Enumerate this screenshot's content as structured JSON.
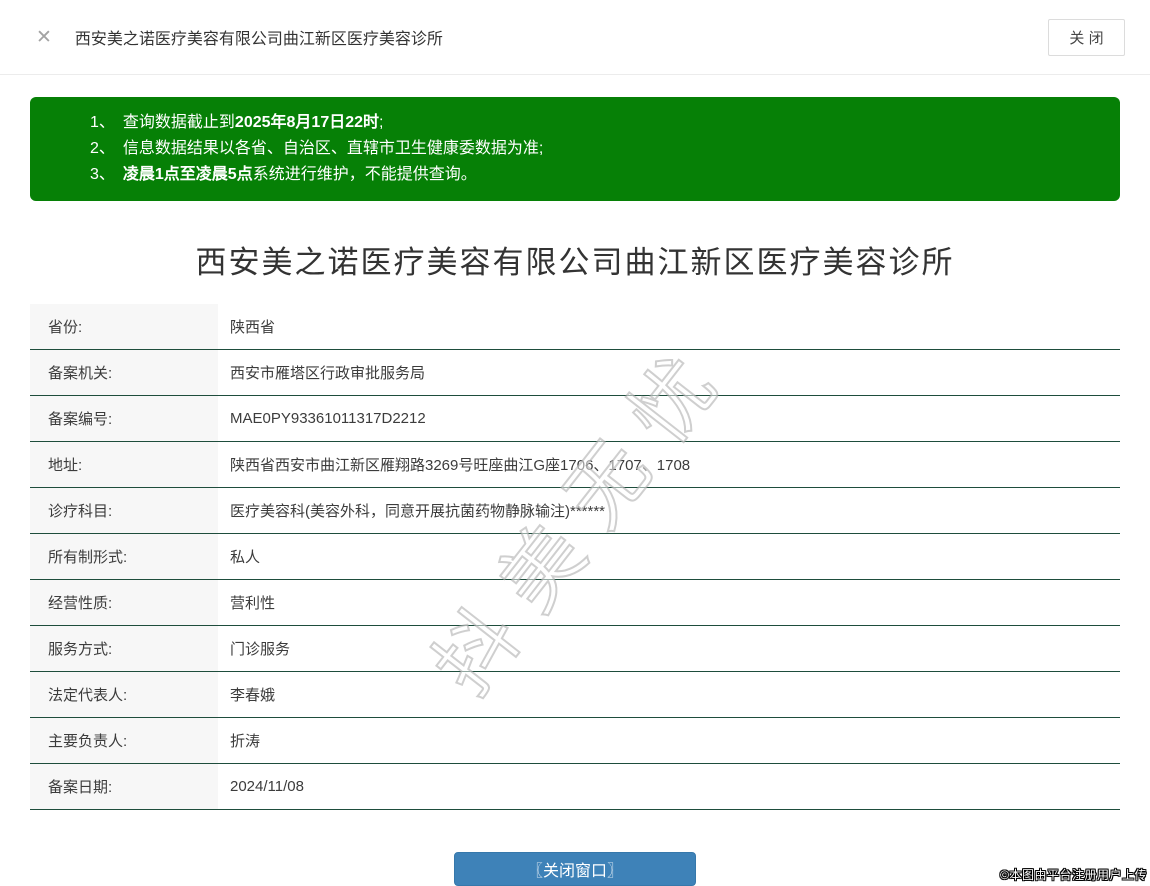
{
  "colors": {
    "notice_bg": "#068006",
    "divider": "#1e4d3c",
    "label_bg": "#f7f7f7",
    "button_blue": "#3e82b8",
    "text": "#3c3c3c"
  },
  "header": {
    "close_icon": "✕",
    "title": "西安美之诺医疗美容有限公司曲江新区医疗美容诊所",
    "close_button_label": "关 闭"
  },
  "notice": {
    "items": [
      {
        "num": "1、",
        "pre": "查询数据截止到",
        "bold": "2025年8月17日22时",
        "post": ";"
      },
      {
        "num": "2、",
        "pre": "信息数据结果以各省、自治区、直辖市卫生健康委数据为准;",
        "bold": "",
        "post": ""
      },
      {
        "num": "3、",
        "pre": "",
        "bold": "凌晨1点至凌晨5点",
        "post": "系统进行维护，不能提供查询。"
      }
    ]
  },
  "page_title": "西安美之诺医疗美容有限公司曲江新区医疗美容诊所",
  "table": {
    "rows": [
      {
        "label": "省份:",
        "value": "陕西省"
      },
      {
        "label": "备案机关:",
        "value": "西安市雁塔区行政审批服务局"
      },
      {
        "label": "备案编号:",
        "value": "MAE0PY93361011317D2212"
      },
      {
        "label": "地址:",
        "value": "陕西省西安市曲江新区雁翔路3269号旺座曲江G座1706、1707、1708"
      },
      {
        "label": "诊疗科目:",
        "value": "医疗美容科(美容外科，同意开展抗菌药物静脉输注)******"
      },
      {
        "label": "所有制形式:",
        "value": "私人"
      },
      {
        "label": "经营性质:",
        "value": "营利性"
      },
      {
        "label": "服务方式:",
        "value": "门诊服务"
      },
      {
        "label": "法定代表人:",
        "value": "李春娥"
      },
      {
        "label": "主要负责人:",
        "value": "折涛"
      },
      {
        "label": "备案日期:",
        "value": "2024/11/08"
      }
    ]
  },
  "bottom": {
    "close_window_button_label": "〖关闭窗口〗"
  },
  "watermark_text": "抖美无忧",
  "copyright_text": "©本图由平台注册用户上传"
}
